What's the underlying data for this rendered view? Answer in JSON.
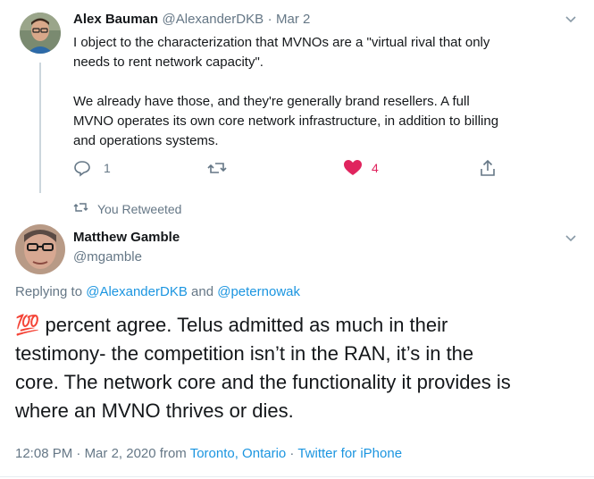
{
  "reply_tweet": {
    "author_name": "Alex Bauman",
    "handle": "@AlexanderDKB",
    "separator": "·",
    "date": "Mar 2",
    "text_line1": "I object to the characterization that MVNOs are a \"virtual rival that only",
    "text_line2": "needs to rent network capacity\".",
    "text_line3": "We already have those, and they're generally brand resellers.  A full",
    "text_line4": "MVNO operates its own core network infrastructure, in addition to billing",
    "text_line5": "and operations systems.",
    "reply_count": "1",
    "like_count": "4",
    "like_color": "#e0245e"
  },
  "retweet_banner": {
    "label": "You Retweeted"
  },
  "main_tweet": {
    "author_name": "Matthew Gamble",
    "handle": "@mgamble",
    "replying_prefix": "Replying to",
    "replying_user1": "@AlexanderDKB",
    "replying_and": "and",
    "replying_user2": "@peternowak",
    "emoji": "💯",
    "text_line1": " percent agree.  Telus admitted as much in their",
    "text_line2": "testimony- the competition isn’t in the RAN, it’s in the",
    "text_line3": "core. The network core and the functionality it provides is",
    "text_line4": "where an MVNO thrives or dies.",
    "time": "12:08 PM",
    "date_sep": "·",
    "date": "Mar 2, 2020",
    "from": "from",
    "location": "Toronto, Ontario",
    "source_sep": "·",
    "source": "Twitter for iPhone"
  },
  "colors": {
    "link": "#1b95e0",
    "muted": "#657786"
  }
}
